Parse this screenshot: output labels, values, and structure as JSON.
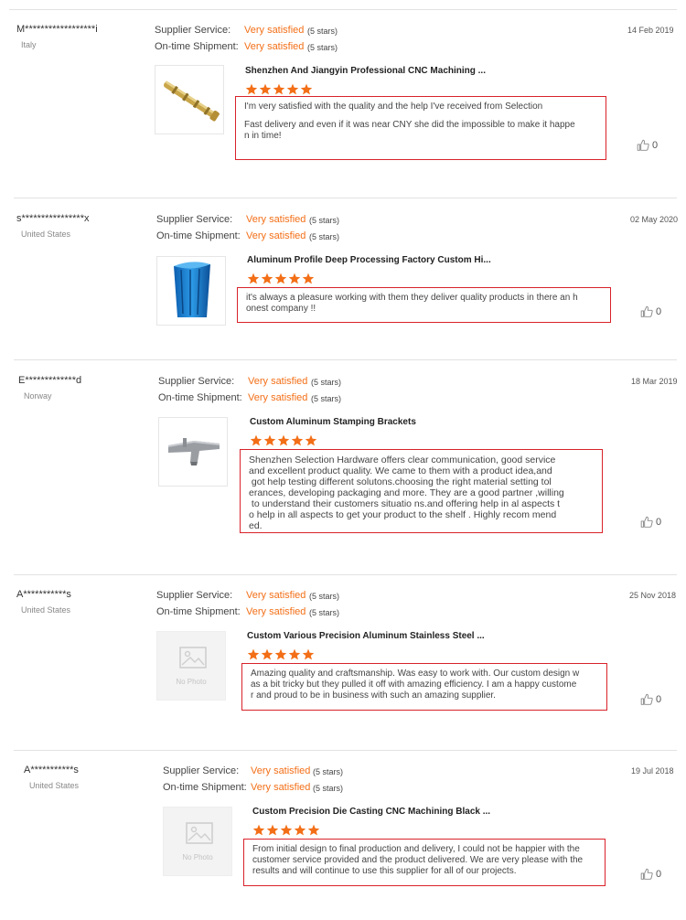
{
  "labels": {
    "supplier_service": "Supplier Service:",
    "on_time_shipment": "On-time Shipment:"
  },
  "no_photo": "No Photo",
  "colors": {
    "accent": "#f36f17",
    "highlight_border": "#d9222a",
    "divider": "#e2e2e2"
  },
  "reviews": [
    {
      "user": "M******************i",
      "country": "Italy",
      "date": "14 Feb 2019",
      "supplier_service": "Very satisfied",
      "supplier_service_stars": "(5 stars)",
      "on_time_shipment": "Very satisfied",
      "on_time_shipment_stars": "(5 stars)",
      "product_title": "Shenzhen And Jiangyin Professional CNC Machining ...",
      "product_image": "brass-rod",
      "rating": 5,
      "comment": [
        "I'm very satisfied with the quality and the help I've received from Selection",
        "Fast delivery and even if it was near CNY she did the impossible to make it happe\nn in time!"
      ],
      "likes": "0"
    },
    {
      "user": "s****************x",
      "country": "United States",
      "date": "02 May 2020",
      "supplier_service": "Very satisfied",
      "supplier_service_stars": "(5 stars)",
      "on_time_shipment": "Very satisfied",
      "on_time_shipment_stars": "(5 stars)",
      "product_title": "Aluminum Profile Deep Processing Factory Custom Hi...",
      "product_image": "blue-aluminum-profile",
      "rating": 5,
      "comment": [
        "it's always a pleasure working with them they deliver quality products in there an h\nonest company !!"
      ],
      "likes": "0"
    },
    {
      "user": "E*************d",
      "country": "Norway",
      "date": "18 Mar 2019",
      "supplier_service": "Very satisfied",
      "supplier_service_stars": "(5 stars)",
      "on_time_shipment": "Very satisfied",
      "on_time_shipment_stars": "(5 stars)",
      "product_title": "Custom Aluminum Stamping Brackets",
      "product_image": "metal-bracket",
      "rating": 5,
      "comment": [
        "Shenzhen Selection Hardware offers clear communication, good service\nand excellent product quality. We came to them with a product idea,and\n got help testing different solutons.choosing the right material setting tol\nerances, developing packaging and more. They are a good partner ,willing\n to understand their customers situatio ns.and offering help in al aspects t\no help in all aspects to get your product to the shelf . Highly recom mend\ned."
      ],
      "likes": "0"
    },
    {
      "user": "A***********s",
      "country": "United States",
      "date": "25 Nov 2018",
      "supplier_service": "Very satisfied",
      "supplier_service_stars": "(5 stars)",
      "on_time_shipment": "Very satisfied",
      "on_time_shipment_stars": "(5 stars)",
      "product_title": "Custom Various Precision Aluminum Stainless Steel ...",
      "product_image": "no-photo",
      "rating": 5,
      "comment": [
        "Amazing quality and craftsmanship. Was easy to work with. Our custom design w\nas a bit tricky but they pulled it off with amazing efficiency. I am a happy custome\nr and proud to be in business with such an amazing supplier."
      ],
      "likes": "0"
    },
    {
      "user": "A***********s",
      "country": "United States",
      "date": "19 Jul 2018",
      "supplier_service": "Very satisfied",
      "supplier_service_stars": "(5 stars)",
      "on_time_shipment": "Very satisfied",
      "on_time_shipment_stars": "(5 stars)",
      "product_title": "Custom Precision Die Casting CNC Machining Black ...",
      "product_image": "no-photo",
      "rating": 5,
      "comment": [
        "From initial design to final production and delivery, I could not be happier with the\ncustomer service provided and the product delivered. We are very please with the\nresults and will continue to use this supplier for all of our projects."
      ],
      "likes": "0"
    }
  ]
}
